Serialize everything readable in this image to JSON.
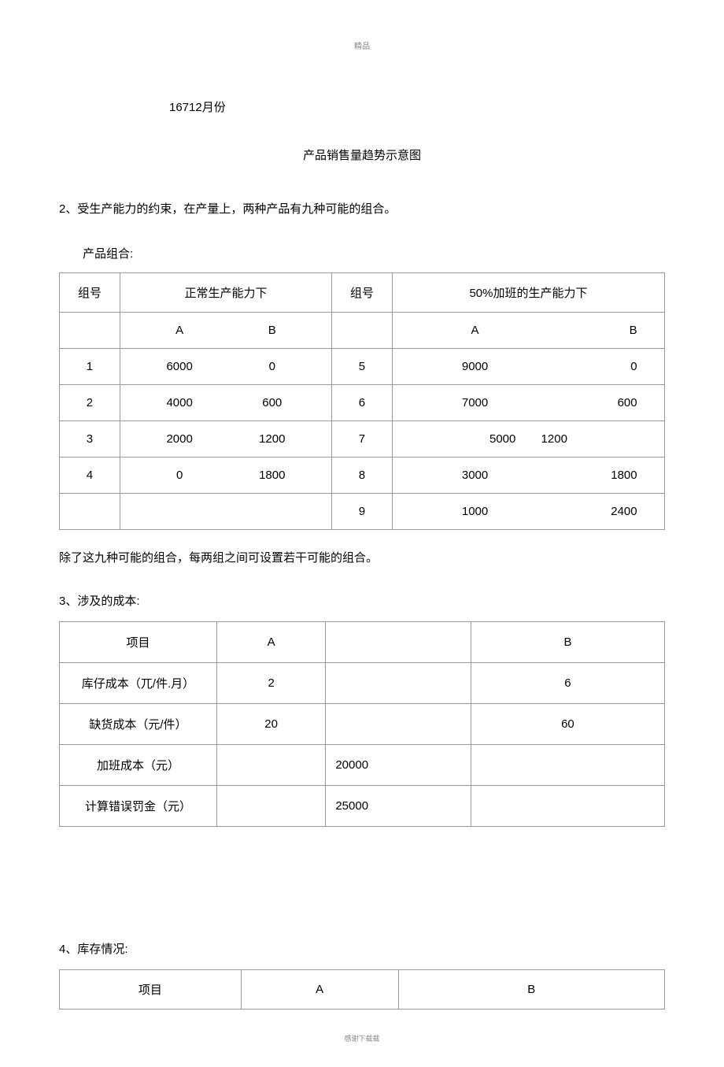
{
  "header_top": "精品",
  "line1": "16712月份",
  "title_sub": "产品销售量趋势示意图",
  "para2": "2、受生产能力的约束，在产量上，两种产品有九种可能的组合。",
  "product_combo_label": "产品组合:",
  "table1": {
    "head": {
      "col1": "组号",
      "col2": "正常生产能力下",
      "col3": "组号",
      "col4": "50%加班的生产能力下",
      "sub_a": "A",
      "sub_b": "B"
    },
    "rows": [
      {
        "g1": "1",
        "c2a": "6000",
        "c2b": "0",
        "g2": "5",
        "c4a": "9000",
        "c4b": "0"
      },
      {
        "g1": "2",
        "c2a": "4000",
        "c2b": "600",
        "g2": "6",
        "c4a": "7000",
        "c4b": "600"
      },
      {
        "g1": "3",
        "c2a": "2000",
        "c2b": "1200",
        "g2": "7",
        "c4a": "5000",
        "c4b": "1200",
        "merged": true
      },
      {
        "g1": "4",
        "c2a": "0",
        "c2b": "1800",
        "g2": "8",
        "c4a": "3000",
        "c4b": "1800"
      },
      {
        "g1": "",
        "c2a": "",
        "c2b": "",
        "g2": "9",
        "c4a": "1000",
        "c4b": "2400"
      }
    ]
  },
  "para_after_t1": "除了这九种可能的组合，每两组之间可设置若干可能的组合。",
  "section3_heading": "3、涉及的成本:",
  "table2": {
    "head": {
      "c1": "项目",
      "c2": "A",
      "c3": "",
      "c4": "B"
    },
    "rows": [
      {
        "c1": "库仔成本（兀/件.月）",
        "c2": "2",
        "c3": "",
        "c4": "6"
      },
      {
        "c1": "缺货成本（元/件）",
        "c2": "20",
        "c3": "",
        "c4": "60"
      },
      {
        "c1": "加班成本（元）",
        "c2": "",
        "c3": "20000",
        "c4": ""
      },
      {
        "c1": "计算错误罚金（元）",
        "c2": "",
        "c3": "25000",
        "c4": ""
      }
    ]
  },
  "section4_heading": "4、库存情况:",
  "table3": {
    "head": {
      "c1": "项目",
      "c2": "A",
      "c3": "B"
    }
  },
  "footer": "感谢下载载"
}
